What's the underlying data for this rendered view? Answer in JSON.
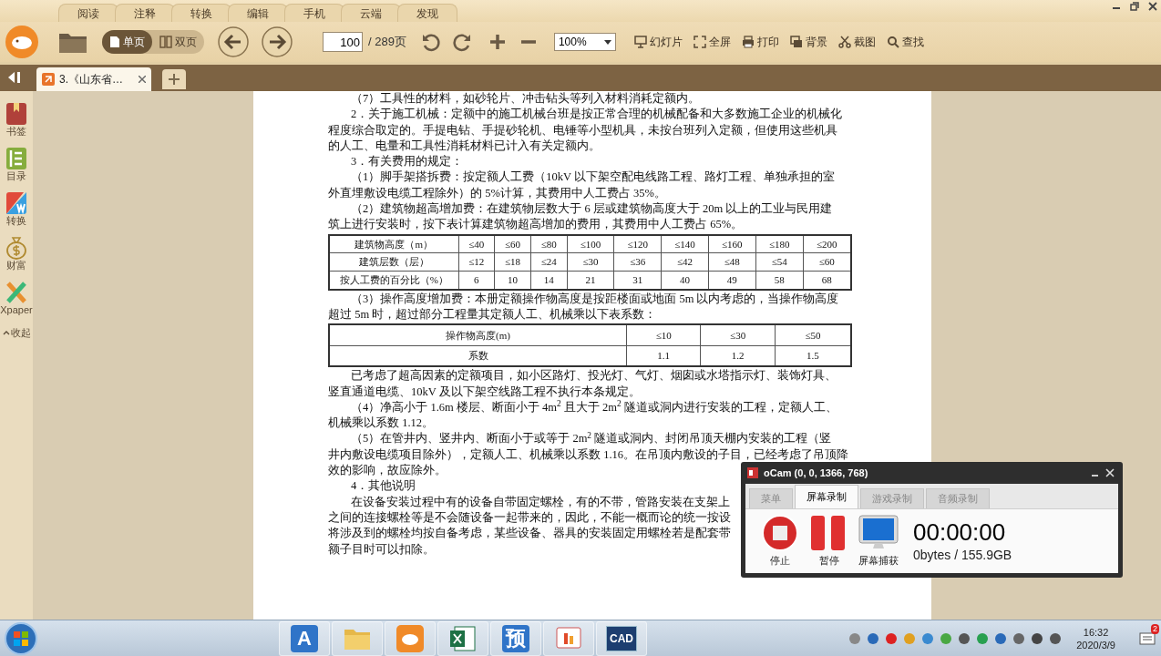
{
  "menu_tabs": [
    {
      "label": "阅读"
    },
    {
      "label": "注释"
    },
    {
      "label": "转换"
    },
    {
      "label": "编辑"
    },
    {
      "label": "手机"
    },
    {
      "label": "云端"
    },
    {
      "label": "发现"
    }
  ],
  "toolbar": {
    "view_modes": [
      {
        "label": "单页",
        "selected": true
      },
      {
        "label": "双页",
        "selected": false
      }
    ],
    "page_input": "100",
    "page_total": "/ 289页",
    "zoom": "100%",
    "actions": [
      {
        "kind": "slides",
        "label": "幻灯片"
      },
      {
        "kind": "fullscreen",
        "label": "全屏"
      },
      {
        "kind": "print",
        "label": "打印"
      },
      {
        "kind": "background",
        "label": "背景"
      },
      {
        "kind": "screenshot",
        "label": "截图"
      },
      {
        "kind": "search",
        "label": "查找"
      }
    ]
  },
  "doc_tabs": [
    {
      "label": "3.《山东省…",
      "selected": true
    }
  ],
  "sidebar": {
    "items": [
      {
        "kind": "bookmark",
        "label": "书签"
      },
      {
        "kind": "toc",
        "label": "目录"
      },
      {
        "kind": "convert",
        "label": "转换"
      },
      {
        "kind": "wealth",
        "label": "财富"
      },
      {
        "kind": "xpaper",
        "label": "Xpaper"
      }
    ],
    "collapse": "收起"
  },
  "document": {
    "blocks": [
      {
        "kind": "p",
        "lines": [
          "（7）工具性的材料，如砂轮片、冲击钻头等列入材料消耗定额内。"
        ]
      },
      {
        "kind": "p",
        "lines": [
          "2．关于施工机械：定额中的施工机械台班是按正常合理的机械配备和大多数施工企业的机械化",
          "程度综合取定的。手提电钻、手提砂轮机、电锤等小型机具，未按台班列入定额，但使用这些机具",
          "的人工、电量和工具性消耗材料已计入有关定额内。"
        ]
      },
      {
        "kind": "p",
        "lines": [
          "3．有关费用的规定："
        ]
      },
      {
        "kind": "p",
        "lines": [
          "（1）脚手架搭拆费：按定额人工费（10kV 以下架空配电线路工程、路灯工程、单独承担的室",
          "外直埋敷设电缆工程除外）的 5%计算，其费用中人工费占 35%。"
        ]
      },
      {
        "kind": "p",
        "lines": [
          "（2）建筑物超高增加费：在建筑物层数大于 6 层或建筑物高度大于 20m 以上的工业与民用建",
          "筑上进行安装时，按下表计算建筑物超高增加的费用，其费用中人工费占 65%。"
        ]
      },
      {
        "kind": "table",
        "rows": [
          [
            "建筑物高度（m）",
            "≤40",
            "≤60",
            "≤80",
            "≤100",
            "≤120",
            "≤140",
            "≤160",
            "≤180",
            "≤200"
          ],
          [
            "建筑层数（层）",
            "≤12",
            "≤18",
            "≤24",
            "≤30",
            "≤36",
            "≤42",
            "≤48",
            "≤54",
            "≤60"
          ],
          [
            "按人工费的百分比（%）",
            "6",
            "10",
            "14",
            "21",
            "31",
            "40",
            "49",
            "58",
            "68"
          ]
        ]
      },
      {
        "kind": "p",
        "lines": [
          "（3）操作高度增加费：本册定额操作物高度是按距楼面或地面 5m 以内考虑的，当操作物高度",
          "超过 5m 时，超过部分工程量其定额人工、机械乘以下表系数："
        ]
      },
      {
        "kind": "table",
        "rows": [
          [
            "操作物高度(m)",
            "≤10",
            "≤30",
            "≤50"
          ],
          [
            "系数",
            "1.1",
            "1.2",
            "1.5"
          ]
        ]
      },
      {
        "kind": "p",
        "lines": [
          "已考虑了超高因素的定额项目，如小区路灯、投光灯、气灯、烟囱或水塔指示灯、装饰灯具、",
          "竖直通道电缆、10kV 及以下架空线路工程不执行本条规定。"
        ]
      },
      {
        "kind": "p",
        "lines": [
          "（4）净高小于 1.6m 楼层、断面小于 4m$^{2}$ 且大于 2m$^{2}$ 隧道或洞内进行安装的工程，定额人工、",
          "机械乘以系数 1.12。"
        ]
      },
      {
        "kind": "p",
        "lines": [
          "（5）在管井内、竖井内、断面小于或等于 2m$^{2}$ 隧道或洞内、封闭吊顶天棚内安装的工程（竖",
          "井内敷设电缆项目除外），定额人工、机械乘以系数 1.16。在吊顶内敷设的子目，已经考虑了吊顶降",
          "效的影响，故应除外。"
        ]
      },
      {
        "kind": "p",
        "lines": [
          "4．其他说明"
        ]
      },
      {
        "kind": "p",
        "lines": [
          "在设备安装过程中有的设备自带固定螺栓，有的不带，管路安装在支架上",
          "之间的连接螺栓等是不会随设备一起带来的，因此，不能一概而论的统一按设",
          "将涉及到的螺栓均按自备考虑，某些设备、器具的安装固定用螺栓若是配套带",
          "额子目时可以扣除。"
        ]
      }
    ]
  },
  "ocam": {
    "title": "oCam (0, 0, 1366, 768)",
    "tabs": [
      {
        "label": "菜单",
        "selected": false
      },
      {
        "label": "屏幕录制",
        "selected": true
      },
      {
        "label": "游戏录制",
        "selected": false
      },
      {
        "label": "音频录制",
        "selected": false
      }
    ],
    "buttons": [
      {
        "kind": "stop",
        "label": "停止"
      },
      {
        "kind": "pause",
        "label": "暂停"
      },
      {
        "kind": "capture",
        "label": "屏幕捕获"
      }
    ],
    "timer": "00:00:00",
    "size": "0bytes / 155.9GB"
  },
  "taskbar": {
    "apps": [
      {
        "kind": "letter",
        "label": "A"
      },
      {
        "kind": "folder"
      },
      {
        "kind": "pdf"
      },
      {
        "kind": "excel"
      },
      {
        "kind": "letter",
        "label": "预"
      },
      {
        "kind": "slides"
      },
      {
        "kind": "cad",
        "label": "CAD"
      }
    ],
    "time": "16:32",
    "date": "2020/3/9",
    "notifications": "2"
  }
}
